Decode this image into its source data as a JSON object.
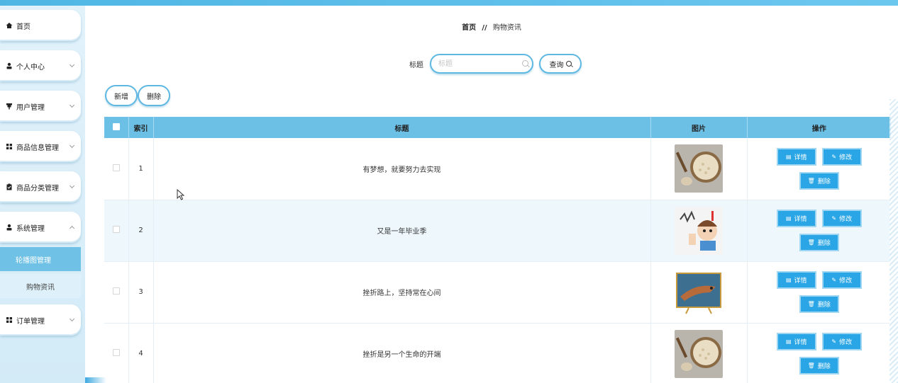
{
  "sidebar": {
    "items": [
      {
        "label": "首页",
        "icon": "home-icon",
        "has_children": false
      },
      {
        "label": "个人中心",
        "icon": "person-icon",
        "has_children": true
      },
      {
        "label": "用户管理",
        "icon": "pin-icon",
        "has_children": true
      },
      {
        "label": "商品信息管理",
        "icon": "grid-icon",
        "has_children": true
      },
      {
        "label": "商品分类管理",
        "icon": "clipboard-icon",
        "has_children": true
      },
      {
        "label": "系统管理",
        "icon": "person-icon",
        "has_children": true
      },
      {
        "label": "订单管理",
        "icon": "grid-icon",
        "has_children": true
      }
    ],
    "submenu": [
      {
        "label": "轮播图管理",
        "active": true
      },
      {
        "label": "购物资讯",
        "active": false
      }
    ]
  },
  "breadcrumb": {
    "home": "首页",
    "separator": "//",
    "current": "购物资讯"
  },
  "search": {
    "label": "标题",
    "placeholder": "标题",
    "button_label": "查询"
  },
  "actions": {
    "add_label": "新增",
    "delete_label": "删除"
  },
  "table": {
    "headers": [
      "索引",
      "标题",
      "图片",
      "操作"
    ],
    "rows": [
      {
        "index": "1",
        "title": "有梦想，就要努力去实现",
        "image": "oats-bowl"
      },
      {
        "index": "2",
        "title": "又是一年毕业季",
        "image": "cartoon-boy"
      },
      {
        "index": "3",
        "title": "挫折路上，坚持常在心间",
        "image": "fish-tv"
      },
      {
        "index": "4",
        "title": "挫折是另一个生命的开端",
        "image": "oats-bowl"
      }
    ],
    "row_actions": {
      "detail": "详情",
      "edit": "修改",
      "delete": "删除"
    }
  },
  "colors": {
    "accent": "#2aa6e6",
    "header_bg": "#6cc0e6",
    "sidebar_active": "#6fc1e6"
  }
}
